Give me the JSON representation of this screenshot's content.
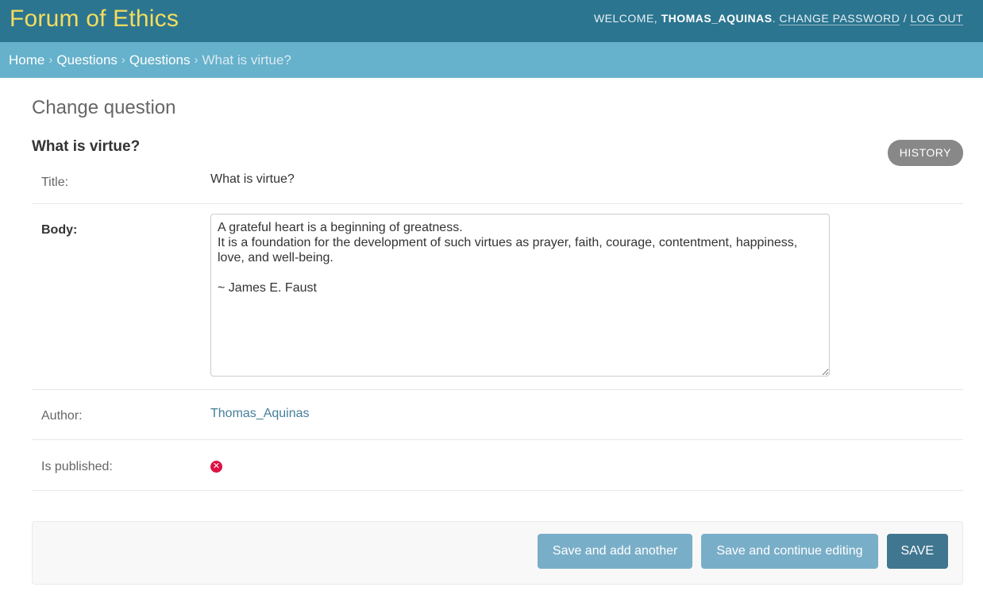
{
  "header": {
    "brand": "Forum of Ethics",
    "welcome": "Welcome, ",
    "username": "Thomas_Aquinas",
    "punct": ". ",
    "change_password": "Change password",
    "separator": " / ",
    "log_out": "Log out"
  },
  "breadcrumbs": [
    {
      "label": "Home"
    },
    {
      "label": "Questions"
    },
    {
      "label": "Questions"
    },
    {
      "label": "What is virtue?"
    }
  ],
  "breadcrumb_separator": "›",
  "page": {
    "title": "Change question",
    "history_button": "History",
    "object_title": "What is virtue?"
  },
  "form": {
    "title_label": "Title:",
    "title_value": "What is virtue?",
    "body_label": "Body:",
    "body_value": "A grateful heart is a beginning of greatness.\nIt is a foundation for the development of such virtues as prayer, faith, courage, contentment, happiness, love, and well-being.\n\n~ James E. Faust",
    "author_label": "Author:",
    "author_value": "Thomas_Aquinas",
    "published_label": "Is published:",
    "published_value": false,
    "published_icon": "x-circle-icon",
    "published_icon_color": "#dd1144"
  },
  "actions": {
    "save_add_another": "Save and add another",
    "save_continue": "Save and continue editing",
    "save": "Save"
  },
  "colors": {
    "header_bg": "#2c7590",
    "brand": "#f5dd5d",
    "breadcrumb_bg": "#66b1cb",
    "button_secondary": "#79aec8",
    "button_primary": "#417690"
  }
}
